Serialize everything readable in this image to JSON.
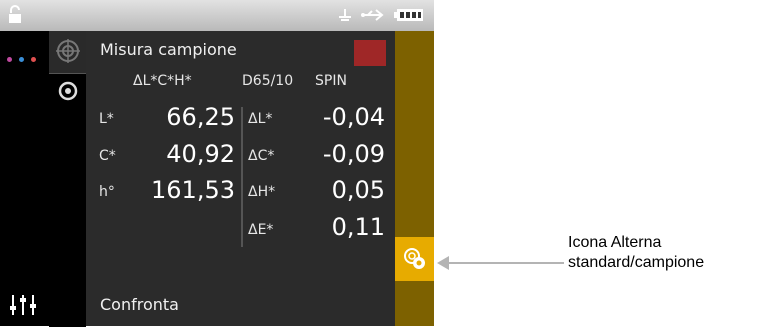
{
  "screen": {
    "title": "Misura campione",
    "header": {
      "mode": "ΔL*C*H*",
      "illuminant": "D65/10",
      "spin": "SPIN"
    },
    "absolute": [
      {
        "label": "L*",
        "value": "66,25"
      },
      {
        "label": "C*",
        "value": "40,92"
      },
      {
        "label": "h°",
        "value": "161,53"
      }
    ],
    "deltas": [
      {
        "label": "ΔL*",
        "value": "-0,04"
      },
      {
        "label": "ΔC*",
        "value": "-0,09"
      },
      {
        "label": "ΔH*",
        "value": "0,05"
      },
      {
        "label": "ΔE*",
        "value": "0,11"
      }
    ],
    "footer": "Confronta",
    "sample_color": "#9f2727"
  },
  "statusbar": {
    "icons": [
      "lock-open-icon",
      "antenna-icon",
      "usb-icon",
      "battery-icon"
    ]
  },
  "sidebar": {
    "dot_colors": [
      "#c04aa0",
      "#3a8fd8",
      "#e05050"
    ]
  },
  "callout": {
    "line1": "Icona Alterna",
    "line2": "standard/campione"
  },
  "colors": {
    "accent": "#e7ab00",
    "rightbar": "#8a6b00"
  }
}
